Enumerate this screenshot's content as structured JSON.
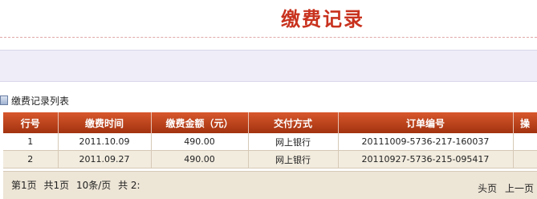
{
  "page": {
    "title": "缴费记录"
  },
  "list": {
    "label": "缴费记录列表"
  },
  "table": {
    "columns": [
      "行号",
      "缴费时间",
      "缴费金额（元）",
      "交付方式",
      "订单编号",
      "操"
    ],
    "rows": [
      [
        "1",
        "2011.10.09",
        "490.00",
        "网上银行",
        "20111009-5736-217-160037",
        ""
      ],
      [
        "2",
        "2011.09.27",
        "490.00",
        "网上银行",
        "20110927-5736-215-095417",
        ""
      ]
    ]
  },
  "pager": {
    "page_info": "第1页",
    "total_pages": "共1页",
    "per_page": "10条/页",
    "total_records": "共 2:",
    "first": "头页",
    "prev": "上一页"
  },
  "colors": {
    "title": "#c8321e",
    "header_bg": "#b9431a",
    "row_alt": "#f2ecdf",
    "footer_bg": "#ede5d6"
  }
}
